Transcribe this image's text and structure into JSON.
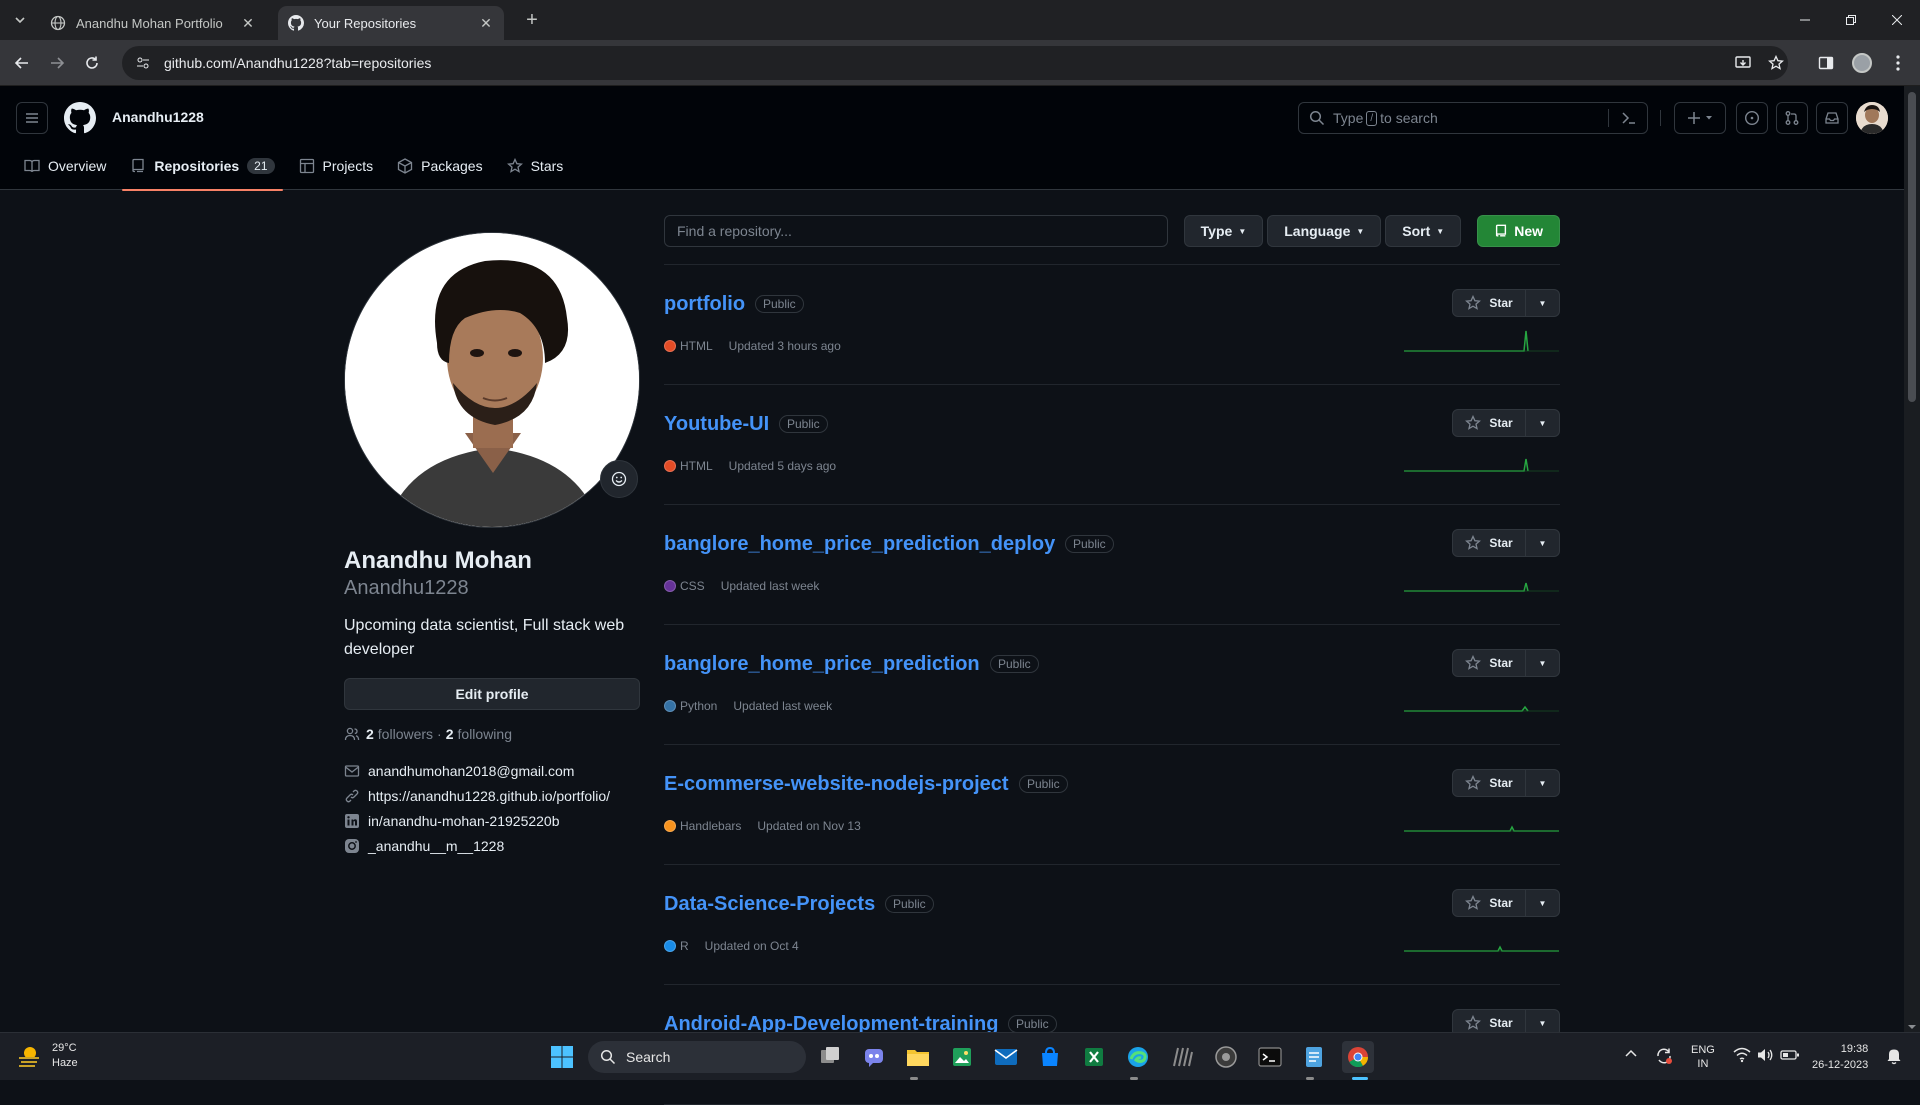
{
  "browser": {
    "tabs": [
      {
        "title": "Anandhu Mohan Portfolio",
        "active": false
      },
      {
        "title": "Your Repositories",
        "active": true
      }
    ],
    "url": "github.com/Anandhu1228?tab=repositories"
  },
  "header": {
    "username": "Anandhu1228",
    "search_prefix": "Type",
    "search_key": "/",
    "search_suffix": "to search"
  },
  "subnav": {
    "overview": "Overview",
    "repositories": "Repositories",
    "repositories_count": "21",
    "projects": "Projects",
    "packages": "Packages",
    "stars": "Stars"
  },
  "profile": {
    "name": "Anandhu Mohan",
    "login": "Anandhu1228",
    "bio": "Upcoming data scientist, Full stack web developer",
    "edit_label": "Edit profile",
    "followers_count": "2",
    "followers_label": "followers",
    "separator": "·",
    "following_count": "2",
    "following_label": "following",
    "email": "anandhumohan2018@gmail.com",
    "website": "https://anandhu1228.github.io/portfolio/",
    "linkedin": "in/anandhu-mohan-21925220b",
    "instagram": "_anandhu__m__1228"
  },
  "filters": {
    "find_placeholder": "Find a repository...",
    "type": "Type",
    "language": "Language",
    "sort": "Sort",
    "new": "New"
  },
  "repos": [
    {
      "name": "portfolio",
      "visibility": "Public",
      "language": "HTML",
      "lang_color": "#e34c26",
      "updated": "Updated 3 hours ago",
      "star": "Star"
    },
    {
      "name": "Youtube-UI",
      "visibility": "Public",
      "language": "HTML",
      "lang_color": "#e34c26",
      "updated": "Updated 5 days ago",
      "star": "Star"
    },
    {
      "name": "banglore_home_price_prediction_deploy",
      "visibility": "Public",
      "language": "CSS",
      "lang_color": "#663399",
      "updated": "Updated last week",
      "star": "Star"
    },
    {
      "name": "banglore_home_price_prediction",
      "visibility": "Public",
      "language": "Python",
      "lang_color": "#3572A5",
      "updated": "Updated last week",
      "star": "Star"
    },
    {
      "name": "E-commerse-website-nodejs-project",
      "visibility": "Public",
      "language": "Handlebars",
      "lang_color": "#f7931e",
      "updated": "Updated on Nov 13",
      "star": "Star"
    },
    {
      "name": "Data-Science-Projects",
      "visibility": "Public",
      "language": "R",
      "lang_color": "#198CE7",
      "updated": "Updated on Oct 4",
      "star": "Star"
    },
    {
      "name": "Android-App-Development-training",
      "visibility": "Public",
      "language": "",
      "lang_color": "",
      "updated": "",
      "star": "Star"
    }
  ],
  "taskbar": {
    "temp": "29°C",
    "condition": "Haze",
    "search": "Search",
    "lang_top": "ENG",
    "lang_bottom": "IN",
    "time": "19:38",
    "date": "26-12-2023"
  }
}
